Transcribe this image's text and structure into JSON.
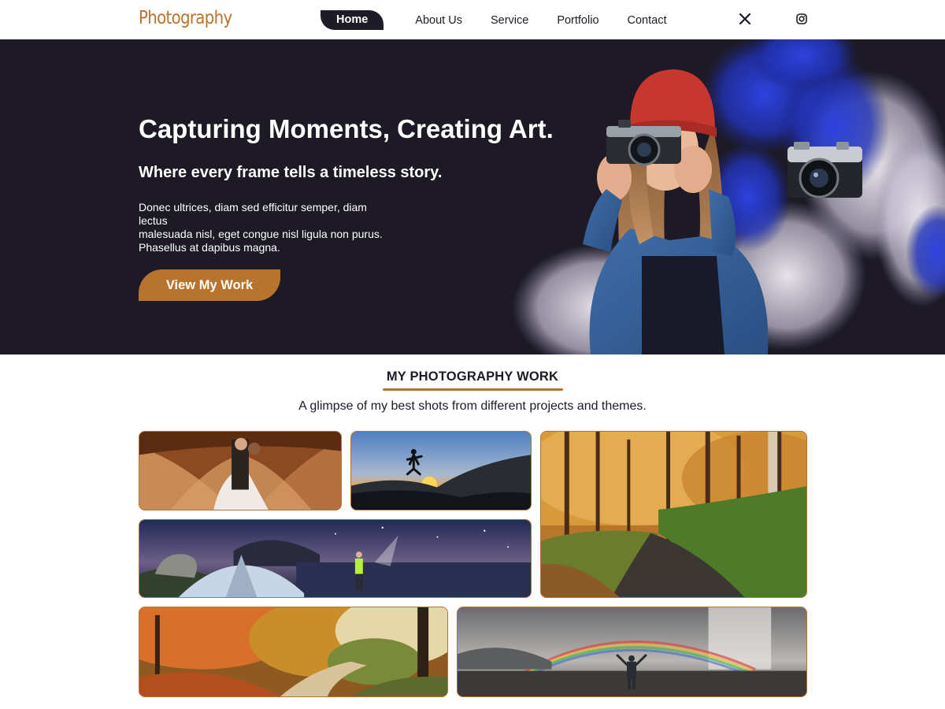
{
  "nav": {
    "brand": "Photography",
    "links": [
      "Home",
      "About Us",
      "Service",
      "Portfolio",
      "Contact"
    ],
    "active": "Home",
    "social": [
      "x-icon",
      "instagram-icon"
    ]
  },
  "hero": {
    "title": "Capturing Moments, Creating Art.",
    "subtitle": "Where every frame tells a timeless story.",
    "description_lines": [
      "Donec ultrices, diam sed efficitur semper, diam",
      "lectus",
      "malesuada nisl, eget congue nisl ligula non purus.",
      "Phasellus at dapibus magna."
    ],
    "cta_label": "View My Work"
  },
  "gallery": {
    "title": "MY PHOTOGRAPHY WORK",
    "subtitle": "A glimpse of my best shots from different projects and themes."
  },
  "colors": {
    "accent": "#b8742f",
    "dark": "#1d1a26",
    "white": "#ffffff"
  }
}
